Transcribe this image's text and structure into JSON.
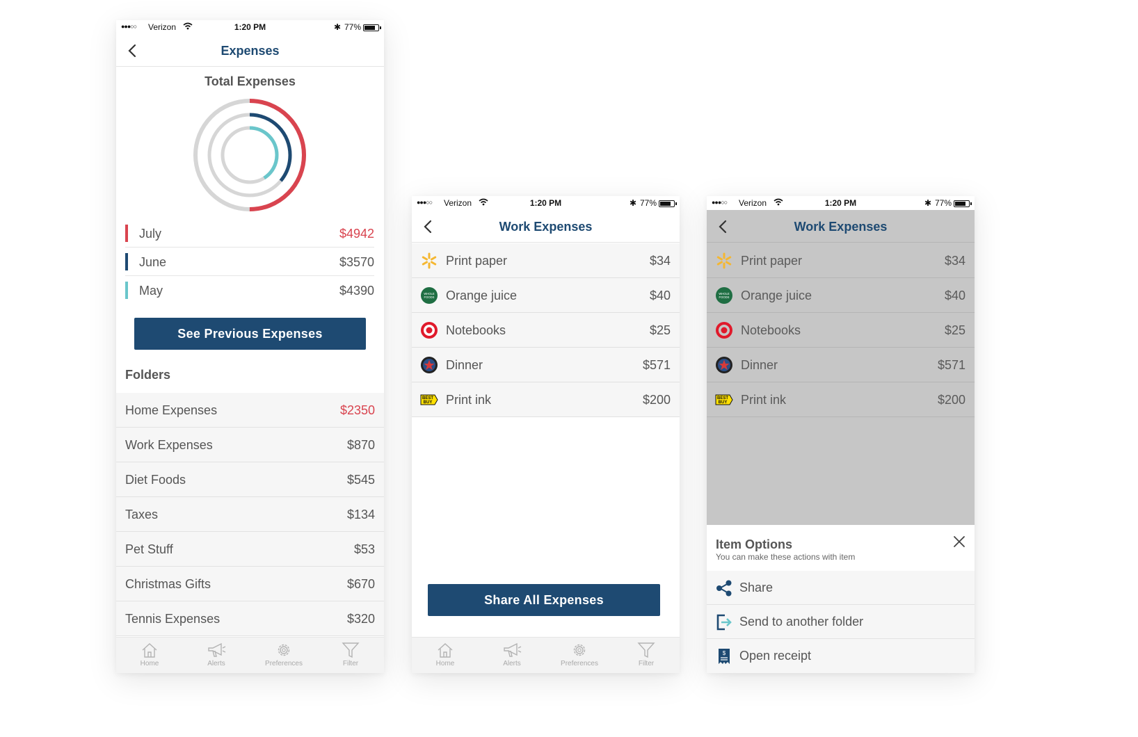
{
  "status_bar": {
    "carrier": "Verizon",
    "time": "1:20 PM",
    "battery_percent": "77%",
    "battery_level": 0.77
  },
  "colors": {
    "brand_blue": "#1e4a72",
    "july_red": "#d9444f",
    "june_navy": "#1e4a72",
    "may_teal": "#6ac6cb",
    "ring_track": "#d6d6d6"
  },
  "screen1": {
    "nav_title": "Expenses",
    "total_title": "Total Expenses",
    "rings": [
      {
        "month": "July",
        "fill_fraction": 0.5
      },
      {
        "month": "June",
        "fill_fraction": 0.36
      },
      {
        "month": "May",
        "fill_fraction": 0.41
      }
    ],
    "months": [
      {
        "label": "July",
        "amount": "$4942",
        "color": "#d9444f",
        "amount_color": "#d9444f"
      },
      {
        "label": "June",
        "amount": "$3570",
        "color": "#1e4a72",
        "amount_color": "#555555"
      },
      {
        "label": "May",
        "amount": "$4390",
        "color": "#6ac6cb",
        "amount_color": "#555555"
      }
    ],
    "see_previous_button": "See Previous Expenses",
    "folders_title": "Folders",
    "folders": [
      {
        "label": "Home Expenses",
        "amount": "$2350",
        "amount_color": "#d9444f"
      },
      {
        "label": "Work Expenses",
        "amount": "$870",
        "amount_color": "#555555"
      },
      {
        "label": "Diet Foods",
        "amount": "$545",
        "amount_color": "#555555"
      },
      {
        "label": "Taxes",
        "amount": "$134",
        "amount_color": "#555555"
      },
      {
        "label": "Pet Stuff",
        "amount": "$53",
        "amount_color": "#555555"
      },
      {
        "label": "Christmas Gifts",
        "amount": "$670",
        "amount_color": "#555555"
      },
      {
        "label": "Tennis Expenses",
        "amount": "$320",
        "amount_color": "#555555"
      }
    ]
  },
  "tabs": [
    {
      "label": "Home",
      "icon": "home-icon"
    },
    {
      "label": "Alerts",
      "icon": "megaphone-icon"
    },
    {
      "label": "Preferences",
      "icon": "gear-icon"
    },
    {
      "label": "Filter",
      "icon": "filter-icon"
    }
  ],
  "screen2": {
    "nav_title": "Work Expenses",
    "items": [
      {
        "label": "Print paper",
        "amount": "$34",
        "store_icon": "walmart-logo-icon"
      },
      {
        "label": "Orange juice",
        "amount": "$40",
        "store_icon": "whole-foods-logo-icon"
      },
      {
        "label": "Notebooks",
        "amount": "$25",
        "store_icon": "target-logo-icon"
      },
      {
        "label": "Dinner",
        "amount": "$571",
        "store_icon": "star-badge-logo-icon"
      },
      {
        "label": "Print ink",
        "amount": "$200",
        "store_icon": "best-buy-logo-icon"
      }
    ],
    "share_all_button": "Share All Expenses"
  },
  "screen3": {
    "nav_title": "Work Expenses",
    "sheet_title": "Item Options",
    "sheet_subtitle": "You can make these actions with item",
    "options": [
      {
        "label": "Share",
        "icon": "share-icon"
      },
      {
        "label": "Send to another folder",
        "icon": "move-to-folder-icon"
      },
      {
        "label": "Open receipt",
        "icon": "receipt-icon"
      }
    ]
  },
  "logo_text": {
    "whole_foods": "WHOLE FOODS",
    "best_buy": "BEST BUY"
  }
}
